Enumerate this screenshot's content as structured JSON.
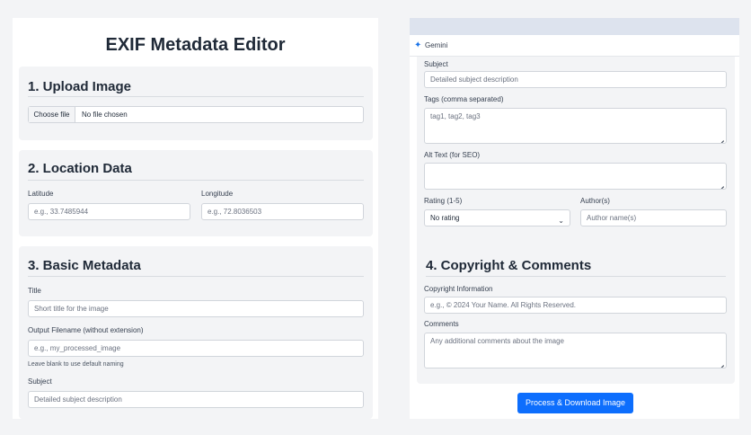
{
  "app": {
    "title": "EXIF Metadata Editor"
  },
  "upload": {
    "heading": "1. Upload Image",
    "file_button": "Choose file",
    "file_status": "No file chosen"
  },
  "location": {
    "heading": "2. Location Data",
    "latitude_label": "Latitude",
    "latitude_placeholder": "e.g., 33.7485944",
    "longitude_label": "Longitude",
    "longitude_placeholder": "e.g., 72.8036503"
  },
  "basic": {
    "heading": "3. Basic Metadata",
    "title_label": "Title",
    "title_placeholder": "Short title for the image",
    "filename_label": "Output Filename (without extension)",
    "filename_placeholder": "e.g., my_processed_image",
    "filename_hint": "Leave blank to use default naming",
    "subject_label": "Subject",
    "subject_placeholder": "Detailed subject description"
  },
  "gemini": {
    "label": "Gemini",
    "icon": "sparkle-icon"
  },
  "details": {
    "subject_label": "Subject",
    "subject_placeholder": "Detailed subject description",
    "tags_label": "Tags (comma separated)",
    "tags_placeholder": "tag1, tag2, tag3",
    "alt_label": "Alt Text (for SEO)",
    "alt_placeholder": "",
    "rating_label": "Rating (1-5)",
    "rating_value": "No rating",
    "author_label": "Author(s)",
    "author_placeholder": "Author name(s)"
  },
  "copyright": {
    "heading": "4. Copyright & Comments",
    "copyright_label": "Copyright Information",
    "copyright_placeholder": "e.g., © 2024 Your Name. All Rights Reserved.",
    "comments_label": "Comments",
    "comments_placeholder": "Any additional comments about the image"
  },
  "actions": {
    "process_label": "Process & Download Image"
  },
  "colors": {
    "accent": "#0d6efd",
    "section_bg": "#f3f4f6",
    "gemini_bar": "#dde3ee"
  }
}
